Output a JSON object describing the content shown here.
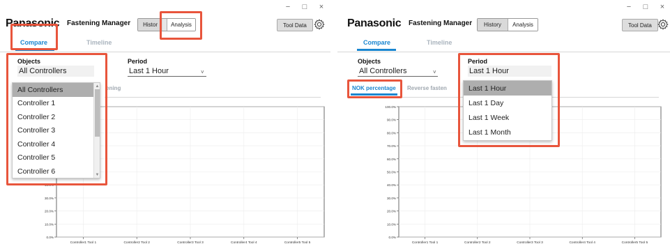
{
  "app": {
    "brand": "Panasonic",
    "title": "Fastening Manager",
    "window_controls": [
      "−",
      "□",
      "×"
    ],
    "segment": {
      "history": "History",
      "analysis": "Analysis",
      "history_truncated": "Histor"
    },
    "tool_data": "Tool Data",
    "tabs": [
      "Compare",
      "Timeline"
    ]
  },
  "filters": {
    "objects_label": "Objects",
    "objects_value": "All Controllers",
    "period_label": "Period",
    "period_value": "Last 1 Hour"
  },
  "subtabs": {
    "nok": "NOK percentage",
    "reverse": "Reverse fasten",
    "reverse_partial": "ening"
  },
  "objects_dropdown": [
    "All Controllers",
    "Controller 1",
    "Controller 2",
    "Controller 3",
    "Controller 4",
    "Controller 5",
    "Controller 6"
  ],
  "period_dropdown": [
    "Last 1 Hour",
    "Last 1 Day",
    "Last 1 Week",
    "Last 1 Month"
  ],
  "colors": {
    "accent": "#1a86d0",
    "highlight": "#e8553c",
    "selected_item": "#aeaeae"
  },
  "chart_data": [
    {
      "type": "bar",
      "title": "",
      "xlabel": "",
      "ylabel": "",
      "categories": [
        "Controller1 Tool 1",
        "Controller2 Tool 2",
        "Controller3 Tool 3",
        "Controller4 Tool 4",
        "Controller5 Tool 5"
      ],
      "values": [
        0,
        0,
        0,
        0,
        0
      ],
      "ylim": [
        0,
        100
      ],
      "ytick_labels": [
        "0.0%",
        "10.0%",
        "20.0%",
        "30.0%",
        "40.0%",
        "50.0%",
        "60.0%",
        "70.0%",
        "80.0%",
        "90.0%",
        "100.0%"
      ],
      "grid": true
    },
    {
      "type": "bar",
      "title": "",
      "xlabel": "",
      "ylabel": "",
      "categories": [
        "Controller1 Tool 1",
        "Controller2 Tool 2",
        "Controller3 Tool 3",
        "Controller4 Tool 4",
        "Controller5 Tool 5"
      ],
      "values": [
        0,
        0,
        0,
        0,
        0
      ],
      "ylim": [
        0,
        100
      ],
      "ytick_labels": [
        "0.0%",
        "10.0%",
        "20.0%",
        "30.0%",
        "40.0%",
        "50.0%",
        "60.0%",
        "70.0%",
        "80.0%",
        "90.0%",
        "100.0%"
      ],
      "grid": true
    }
  ]
}
